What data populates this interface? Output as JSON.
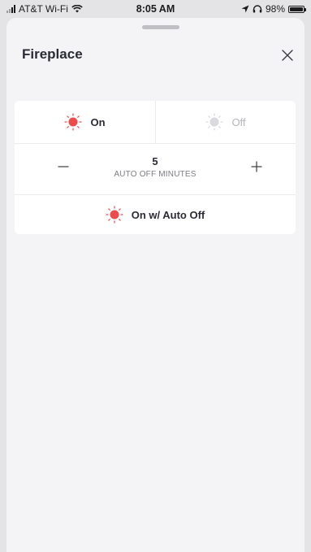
{
  "status_bar": {
    "carrier": "AT&T Wi-Fi",
    "time": "8:05 AM",
    "battery": "98%",
    "battery_level": 0.98
  },
  "header": {
    "title": "Fireplace",
    "close_icon": "close-icon"
  },
  "power": {
    "on_label": "On",
    "off_label": "Off",
    "selected": "on"
  },
  "auto_off": {
    "minutes_value": "5",
    "minutes_label": "AUTO OFF MINUTES",
    "decrement_icon": "minus-icon",
    "increment_icon": "plus-icon",
    "action_label": "On w/ Auto Off"
  },
  "colors": {
    "active_sun": "#ee4b4b",
    "inactive_sun": "#d9d9de",
    "text": "#2b2b36"
  }
}
